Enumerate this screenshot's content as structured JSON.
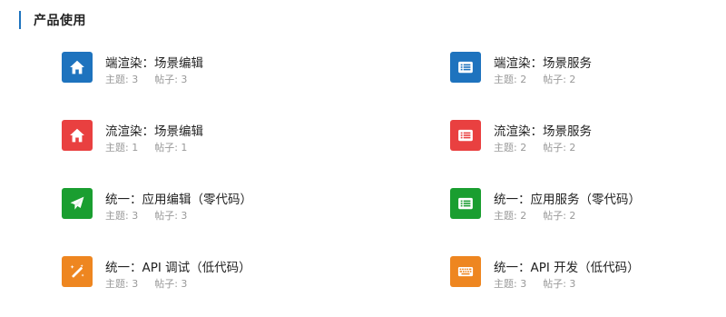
{
  "section": {
    "title": "产品使用"
  },
  "forums": [
    {
      "name": "端渲染：场景编辑",
      "stats": [
        "主题: 3",
        "帖子: 3"
      ],
      "color": "#1e73be",
      "icon": "home-icon"
    },
    {
      "name": "端渲染：场景服务",
      "stats": [
        "主题: 2",
        "帖子: 2"
      ],
      "color": "#1e73be",
      "icon": "list-icon"
    },
    {
      "name": "流渲染：场景编辑",
      "stats": [
        "主题: 1",
        "帖子: 1"
      ],
      "color": "#e94040",
      "icon": "home-icon"
    },
    {
      "name": "流渲染：场景服务",
      "stats": [
        "主题: 2",
        "帖子: 2"
      ],
      "color": "#e94040",
      "icon": "list-icon"
    },
    {
      "name": "统一：应用编辑（零代码）",
      "stats": [
        "主题: 3",
        "帖子: 3"
      ],
      "color": "#1a9e30",
      "icon": "paper-plane-icon"
    },
    {
      "name": "统一：应用服务（零代码）",
      "stats": [
        "主题: 2",
        "帖子: 2"
      ],
      "color": "#1a9e30",
      "icon": "list-icon"
    },
    {
      "name": "统一：API 调试（低代码）",
      "stats": [
        "主题: 3",
        "帖子: 3"
      ],
      "color": "#ee8620",
      "icon": "magic-wand-icon"
    },
    {
      "name": "统一：API 开发（低代码）",
      "stats": [
        "主题: 3",
        "帖子: 3"
      ],
      "color": "#ee8620",
      "icon": "keyboard-icon"
    }
  ]
}
